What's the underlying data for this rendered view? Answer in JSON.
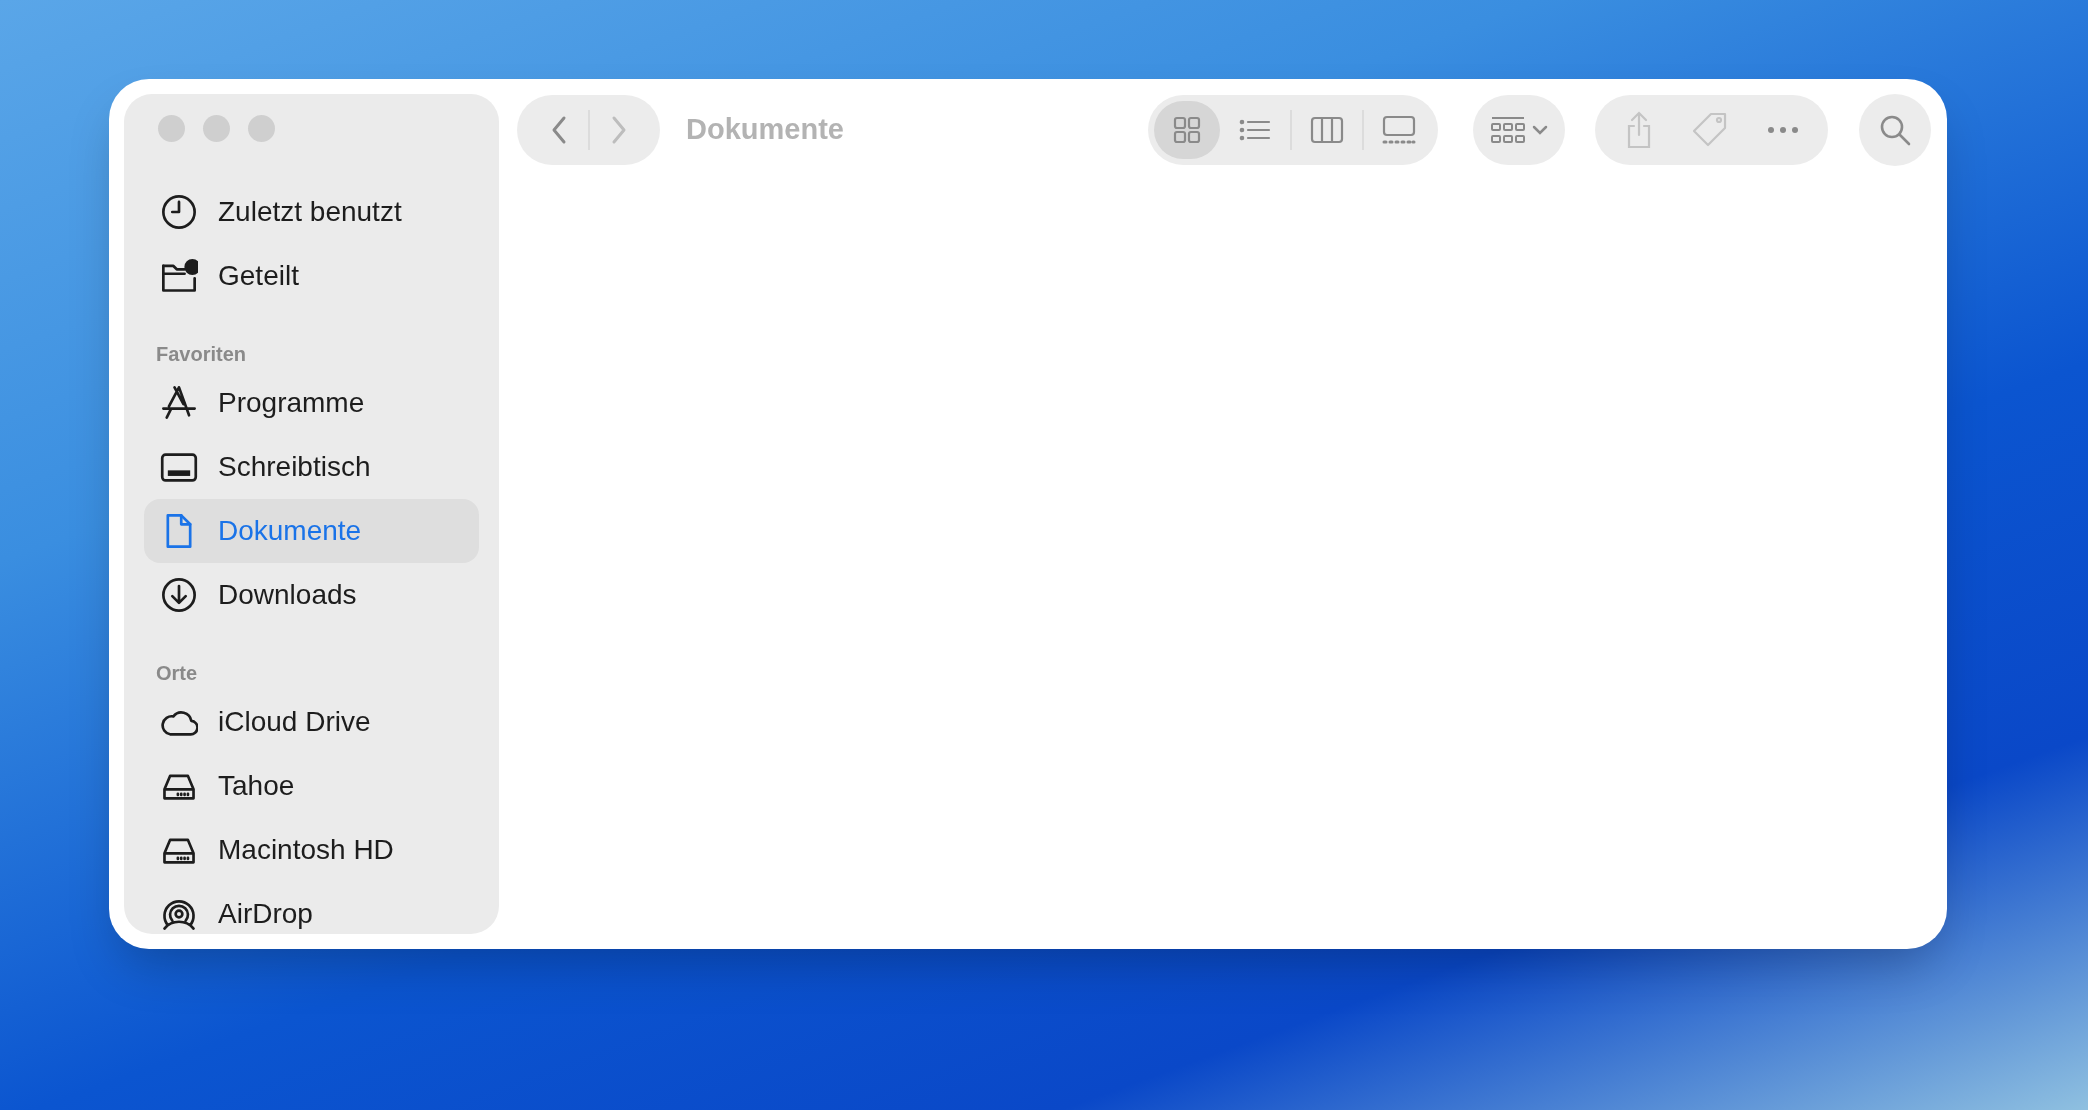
{
  "window": {
    "title": "Dokumente"
  },
  "sidebar": {
    "sections": [
      {
        "items": [
          {
            "label": "Zuletzt benutzt",
            "kind": "clock",
            "selected": false
          },
          {
            "label": "Geteilt",
            "kind": "shared",
            "selected": false
          }
        ]
      },
      {
        "heading": "Favoriten",
        "items": [
          {
            "label": "Programme",
            "kind": "apps",
            "selected": false
          },
          {
            "label": "Schreibtisch",
            "kind": "desktop",
            "selected": false
          },
          {
            "label": "Dokumente",
            "kind": "doc",
            "selected": true
          },
          {
            "label": "Downloads",
            "kind": "download",
            "selected": false
          }
        ]
      },
      {
        "heading": "Orte",
        "items": [
          {
            "label": "iCloud Drive",
            "kind": "cloud",
            "selected": false
          },
          {
            "label": "Tahoe",
            "kind": "disk",
            "selected": false
          },
          {
            "label": "Macintosh HD",
            "kind": "disk",
            "selected": false
          },
          {
            "label": "AirDrop",
            "kind": "airdrop",
            "selected": false
          }
        ]
      }
    ]
  },
  "view_modes": [
    {
      "kind": "icons",
      "selected": true
    },
    {
      "kind": "list",
      "selected": false
    },
    {
      "kind": "columns",
      "selected": false
    },
    {
      "kind": "gallery",
      "selected": false
    }
  ]
}
